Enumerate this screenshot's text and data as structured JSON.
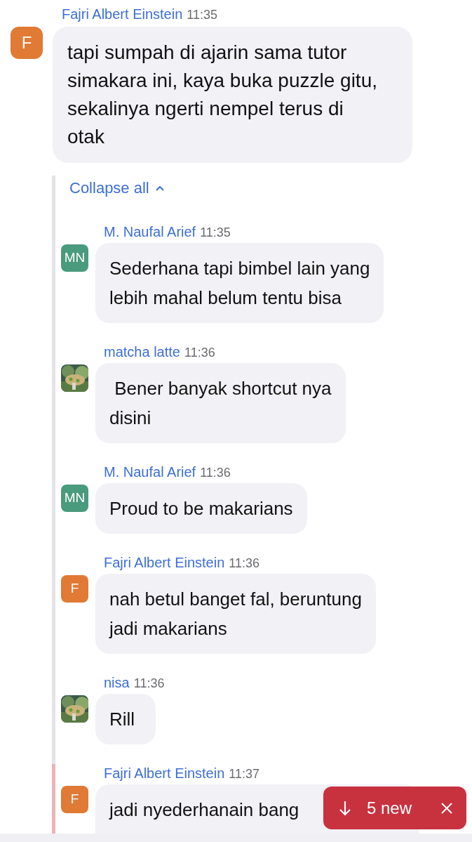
{
  "message": {
    "author": "Fajri Albert Einstein",
    "time": "11:35",
    "avatar": {
      "kind": "initials",
      "initials": "F",
      "color": "#e07a35"
    },
    "lines": [
      "tapi sumpah di ajarin sama tutor",
      "simakara ini, kaya buka puzzle gitu,",
      "sekalinya ngerti nempel terus di",
      "otak"
    ]
  },
  "thread": {
    "collapse_label": "Collapse all",
    "replies": [
      {
        "author": "M. Naufal Arief",
        "time": "11:35",
        "avatar": {
          "kind": "initials",
          "initials": "MN",
          "color": "#4a9a7e"
        },
        "lines": [
          "Sederhana tapi bimbel lain yang",
          "lebih mahal belum tentu bisa"
        ],
        "unread": false
      },
      {
        "author": "matcha latte",
        "time": "11:36",
        "avatar": {
          "kind": "picture"
        },
        "lines": [
          " Bener banyak shortcut nya",
          "disini"
        ],
        "unread": false
      },
      {
        "author": "M. Naufal Arief",
        "time": "11:36",
        "avatar": {
          "kind": "initials",
          "initials": "MN",
          "color": "#4a9a7e"
        },
        "lines": [
          "Proud to be makarians"
        ],
        "unread": false
      },
      {
        "author": "Fajri Albert Einstein",
        "time": "11:36",
        "avatar": {
          "kind": "initials",
          "initials": "F",
          "color": "#e07a35"
        },
        "lines": [
          "nah betul banget fal, beruntung",
          "jadi makarians"
        ],
        "unread": false
      },
      {
        "author": "nisa",
        "time": "11:36",
        "avatar": {
          "kind": "picture"
        },
        "lines": [
          "Rill"
        ],
        "unread": false
      },
      {
        "author": "Fajri Albert Einstein",
        "time": "11:37",
        "avatar": {
          "kind": "initials",
          "initials": "F",
          "color": "#e07a35"
        },
        "lines": [
          "jadi nyederhanain bang"
        ],
        "unread": true
      }
    ]
  },
  "new_messages": {
    "label": "5 new"
  }
}
